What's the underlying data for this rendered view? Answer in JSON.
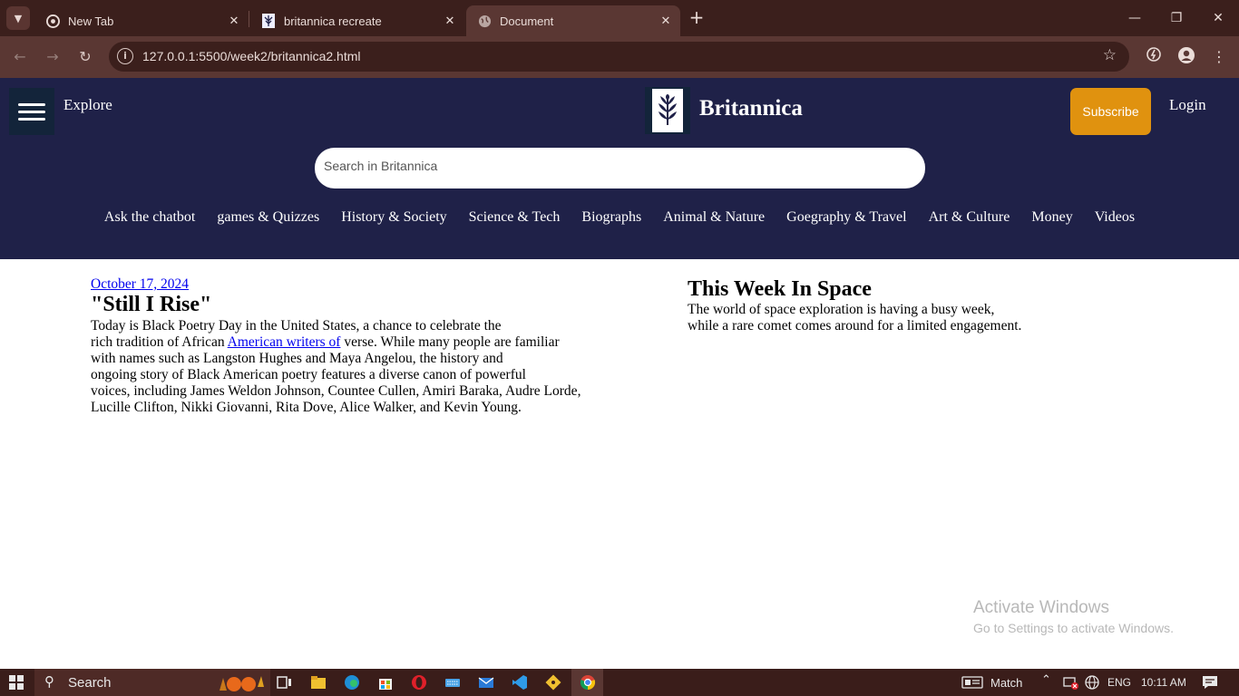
{
  "browser": {
    "tabs": [
      {
        "title": "New Tab",
        "icon": "chrome-icon"
      },
      {
        "title": "britannica recreate",
        "icon": "britannica-favicon"
      },
      {
        "title": "Document",
        "icon": "globe-icon",
        "active": true
      }
    ],
    "url": "127.0.0.1:5500/week2/britannica2.html"
  },
  "header": {
    "explore": "Explore",
    "brand": "Britannica",
    "subscribe": "Subscribe",
    "login": "Login",
    "search_placeholder": "Search in Britannica",
    "topics": [
      "Ask the chatbot",
      "games & Quizzes",
      "History & Society",
      "Science & Tech",
      "Biographs",
      "Animal & Nature",
      "Goegraphy & Travel",
      "Art & Culture",
      "Money",
      "Videos"
    ]
  },
  "article": {
    "date": "October 17, 2024",
    "title": "\"Still I Rise\"",
    "line1": "Today is Black Poetry Day in the United States, a chance to celebrate the",
    "line2_pre": "rich tradition of African ",
    "line2_link": "American writers of",
    "line2_post": " verse. While many people are familiar",
    "line3": "with names such as Langston Hughes and Maya Angelou, the history and",
    "line4": "ongoing story of Black American poetry features a diverse canon of powerful",
    "line5": "voices, including James Weldon Johnson, Countee Cullen, Amiri Baraka, Audre Lorde,",
    "line6": "Lucille Clifton, Nikki Giovanni, Rita Dove, Alice Walker, and Kevin Young."
  },
  "space": {
    "title": "This Week In Space",
    "line1": "The world of space exploration is having a busy week,",
    "line2": "while a rare comet comes around for a limited engagement."
  },
  "watermark": {
    "line1": "Activate Windows",
    "line2": "Go to Settings to activate Windows."
  },
  "taskbar": {
    "search": "Search",
    "weather": "Match",
    "lang": "ENG",
    "time": "10:11 AM"
  }
}
